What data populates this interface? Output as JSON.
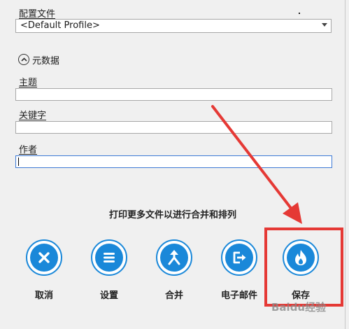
{
  "profile": {
    "label": "配置文件",
    "selected": "<Default Profile>"
  },
  "metadata": {
    "section_label": "元数据",
    "subject_label": "主题",
    "subject_value": "",
    "keywords_label": "关键字",
    "keywords_value": "",
    "author_label": "作者",
    "author_value": ""
  },
  "hint": "打印更多文件以进行合并和排列",
  "actions": [
    {
      "label": "取消",
      "icon": "close-icon"
    },
    {
      "label": "设置",
      "icon": "settings-list-icon"
    },
    {
      "label": "合并",
      "icon": "merge-icon"
    },
    {
      "label": "电子邮件",
      "icon": "email-export-icon"
    },
    {
      "label": "保存",
      "icon": "flame-icon"
    }
  ],
  "annotation": {
    "color": "#e53935"
  },
  "colors": {
    "accent": "#1a88d9"
  },
  "watermark": "Baidu经验"
}
